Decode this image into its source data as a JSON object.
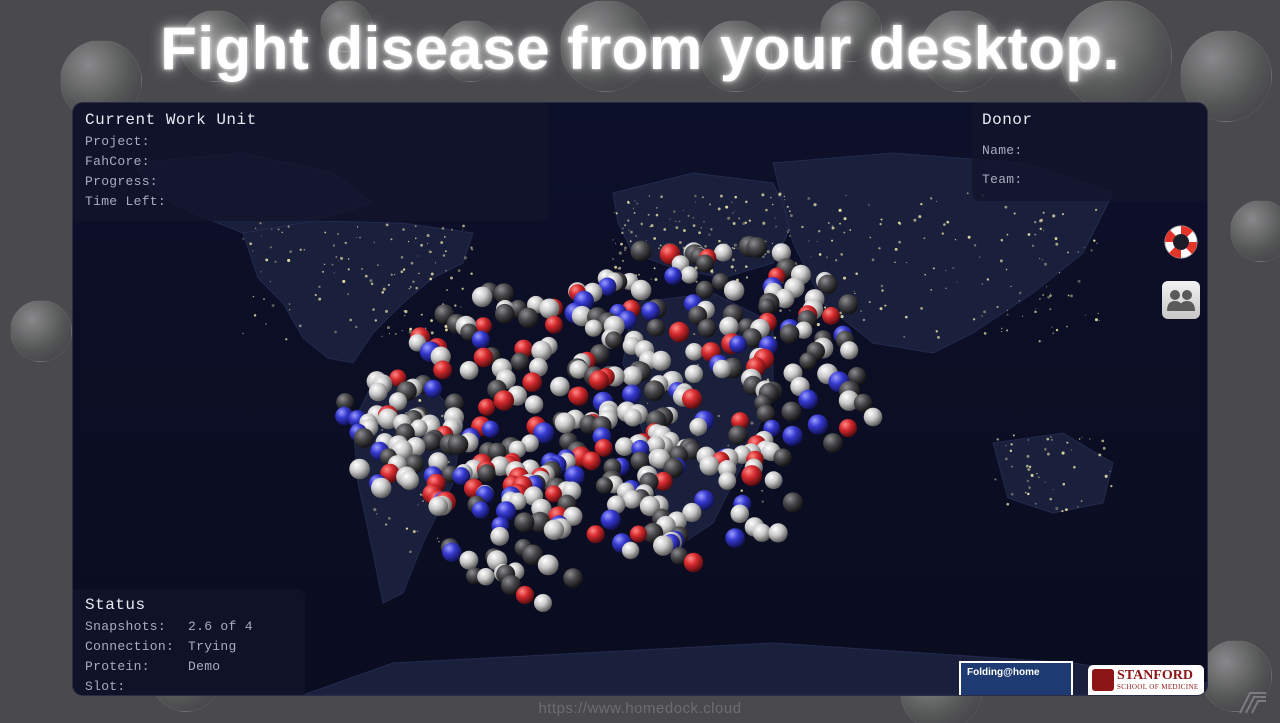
{
  "headline": "Fight disease from your desktop.",
  "current_work_unit": {
    "title": "Current Work Unit",
    "fields": [
      {
        "label": "Project:",
        "value": ""
      },
      {
        "label": "FahCore:",
        "value": ""
      },
      {
        "label": "Progress:",
        "value": ""
      },
      {
        "label": "Time Left:",
        "value": ""
      }
    ]
  },
  "donor": {
    "title": "Donor",
    "fields": [
      {
        "label": "Name:",
        "value": ""
      },
      {
        "label": "Team:",
        "value": ""
      }
    ]
  },
  "status": {
    "title": "Status",
    "fields": [
      {
        "label": "Snapshots:",
        "value": "2.6 of 4"
      },
      {
        "label": "Connection:",
        "value": "Trying"
      },
      {
        "label": "Protein:",
        "value": "Demo"
      },
      {
        "label": "Slot:",
        "value": ""
      }
    ]
  },
  "icons": {
    "help": "lifebuoy-icon",
    "team": "team-icon"
  },
  "logos": {
    "folding": "Folding@home",
    "stanford_name": "STANFORD",
    "stanford_sub": "SCHOOL OF MEDICINE"
  },
  "url": "https://www.homedock.cloud",
  "colors": {
    "atom_red": "#d2262b",
    "atom_blue": "#3438d4",
    "atom_white": "#d6d6d6",
    "atom_dark": "#3d3d3f",
    "map_background": "#0b0d22"
  }
}
